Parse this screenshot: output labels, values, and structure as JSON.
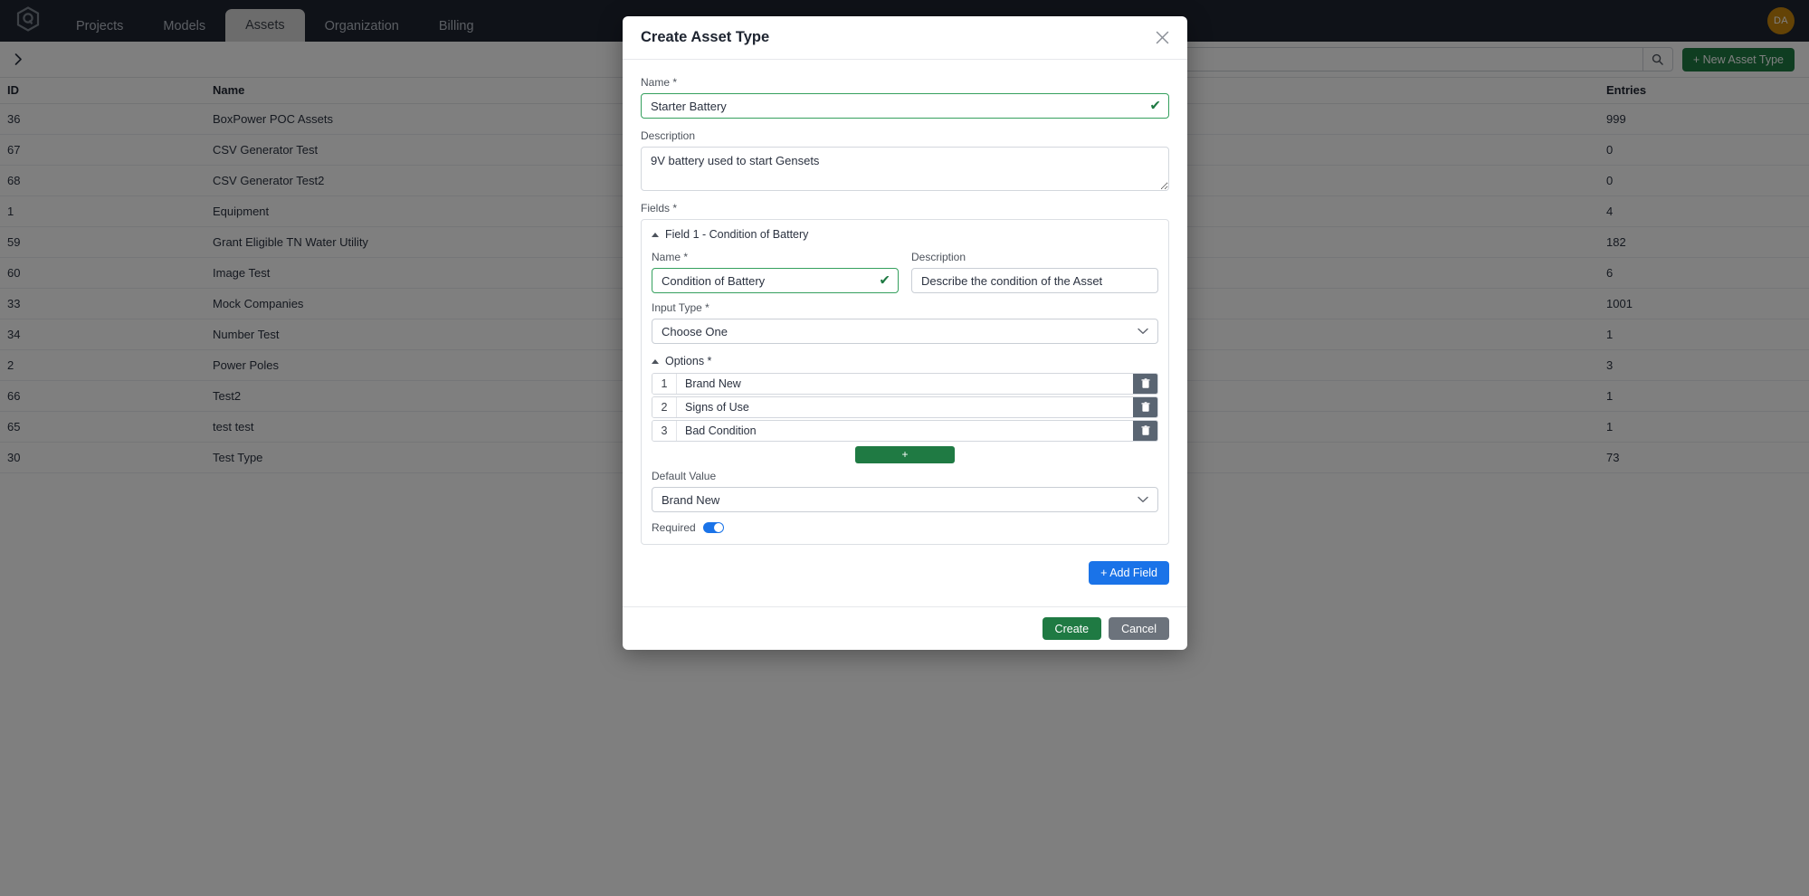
{
  "topbar": {
    "logo_name": "hexagon-q-logo",
    "tabs": [
      {
        "label": "Projects",
        "active": false
      },
      {
        "label": "Models",
        "active": false
      },
      {
        "label": "Assets",
        "active": true
      },
      {
        "label": "Organization",
        "active": false
      },
      {
        "label": "Billing",
        "active": false
      }
    ],
    "avatar_initials": "DA",
    "avatar_color": "#c8860d",
    "background_color": "#1e2430"
  },
  "toolbar": {
    "sidebar_toggle_icon": "chevron-right-icon",
    "search_value": "",
    "search_placeholder": "",
    "search_icon": "search-icon",
    "new_asset_type_label": "+ New Asset Type",
    "new_asset_type_color": "#1f7a43"
  },
  "table": {
    "columns": [
      "ID",
      "Name",
      "Entries"
    ],
    "rows": [
      {
        "id": "36",
        "name": "BoxPower POC Assets",
        "entries": "999"
      },
      {
        "id": "67",
        "name": "CSV Generator Test",
        "entries": "0"
      },
      {
        "id": "68",
        "name": "CSV Generator Test2",
        "entries": "0"
      },
      {
        "id": "1",
        "name": "Equipment",
        "entries": "4"
      },
      {
        "id": "59",
        "name": "Grant Eligible TN Water Utility",
        "entries": "182"
      },
      {
        "id": "60",
        "name": "Image Test",
        "entries": "6"
      },
      {
        "id": "33",
        "name": "Mock Companies",
        "entries": "1001"
      },
      {
        "id": "34",
        "name": "Number Test",
        "entries": "1"
      },
      {
        "id": "2",
        "name": "Power Poles",
        "entries": "3"
      },
      {
        "id": "66",
        "name": "Test2",
        "entries": "1"
      },
      {
        "id": "65",
        "name": "test test",
        "entries": "1"
      },
      {
        "id": "30",
        "name": "Test Type",
        "entries": "73"
      }
    ]
  },
  "modal": {
    "title": "Create Asset Type",
    "close_icon": "close-icon",
    "name_label": "Name *",
    "name_value": "Starter Battery",
    "name_valid_icon": "check-icon",
    "description_label": "Description",
    "description_value": "9V battery used to start Gensets",
    "fields_label": "Fields *",
    "field": {
      "header": "Field 1 - Condition of Battery",
      "collapse_icon": "caret-up-icon",
      "name_label": "Name *",
      "name_value": "Condition of Battery",
      "name_valid_icon": "check-icon",
      "description_label": "Description",
      "description_value": "Describe the condition of the Asset",
      "input_type_label": "Input Type *",
      "input_type_value": "Choose One",
      "input_type_chevron": "chevron-down-icon",
      "options_label": "Options *",
      "options_collapse_icon": "caret-up-icon",
      "options": [
        {
          "index": "1",
          "value": "Brand New",
          "delete_icon": "trash-icon"
        },
        {
          "index": "2",
          "value": "Signs of Use",
          "delete_icon": "trash-icon"
        },
        {
          "index": "3",
          "value": "Bad Condition",
          "delete_icon": "trash-icon"
        }
      ],
      "add_option_label": "+",
      "default_value_label": "Default Value",
      "default_value": "Brand New",
      "default_value_chevron": "chevron-down-icon",
      "required_label": "Required",
      "required_on": true
    },
    "add_field_label": "+ Add Field",
    "create_label": "Create",
    "cancel_label": "Cancel",
    "accent_green": "#1f7a43",
    "accent_blue": "#1a73e8"
  }
}
